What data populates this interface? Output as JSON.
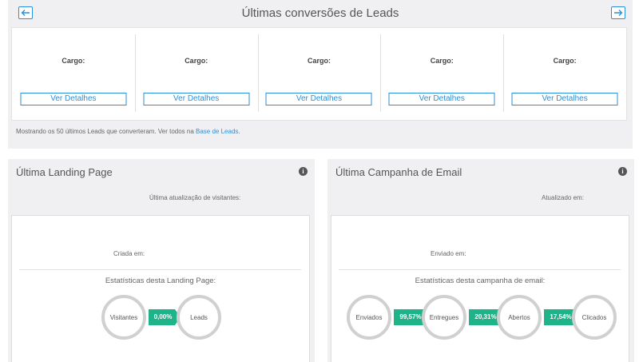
{
  "leads": {
    "title": "Últimas conversões de Leads",
    "cargo_label": "Cargo:",
    "details_label": "Ver Detalhes",
    "footer_text": "Mostrando os 50 últimos Leads que converteram. Ver todos na ",
    "footer_link": "Base de Leads",
    "footer_end": "."
  },
  "landing": {
    "title": "Última Landing Page",
    "info_glyph": "i",
    "visitors_update": "Última atualização de visitantes:",
    "created": "Criada em:",
    "stats_title": "Estatísticas desta Landing Page:",
    "funnel": {
      "visitors": "Visitantes",
      "rate": "0,00%",
      "leads": "Leads"
    }
  },
  "email": {
    "title": "Última Campanha de Email",
    "info_glyph": "i",
    "updated": "Atualizado em:",
    "sent_at": "Enviado em:",
    "stats_title": "Estatísticas desta campanha de email:",
    "funnel": {
      "sent": "Enviados",
      "rate_delivered": "99,57%",
      "delivered": "Entregues",
      "rate_opened": "20,31%",
      "opened": "Abertos",
      "rate_clicked": "17,54%",
      "clicked": "Clicados"
    }
  },
  "icons": {
    "prev": "arrow-left-icon",
    "next": "arrow-right-icon",
    "info": "info-icon"
  },
  "colors": {
    "accent": "#2d8fd6",
    "funnel_green": "#1fb389",
    "panel_bg": "#f0f0f2",
    "circle_border": "#d0d0d0"
  }
}
